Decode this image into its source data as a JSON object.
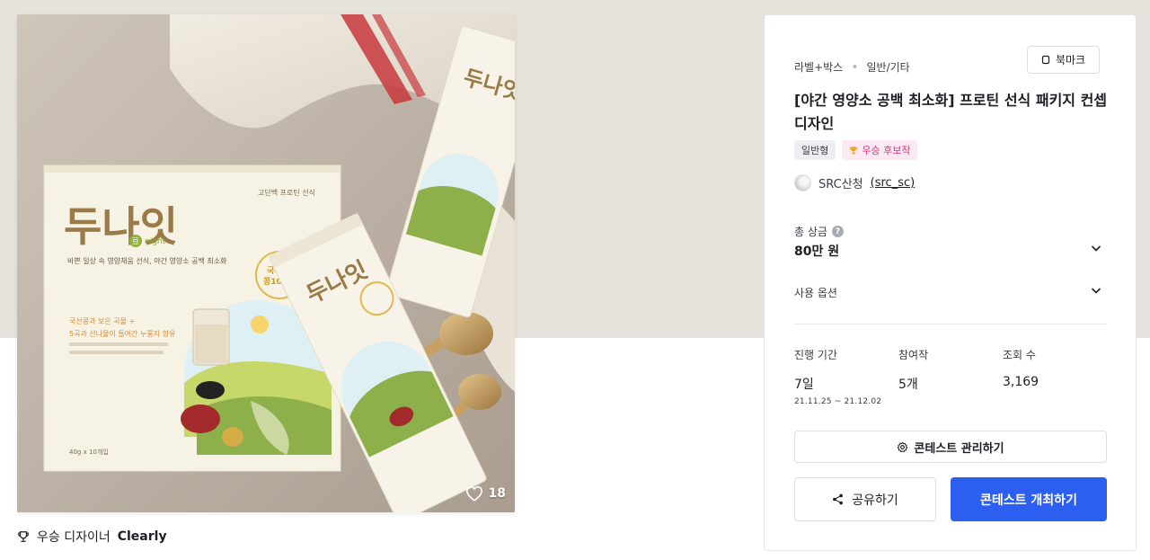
{
  "hero": {
    "box_brand": "두나잇",
    "box_sub_badge": "豆",
    "box_sub_text": "night",
    "box_top_text": "고단백 프로틴 선식",
    "box_tagline": "바쁜 일상 속 영양채움 선식, 야간 영양소 공백 최소화",
    "box_promo_1": "국산콩과 보은 곡물 +",
    "box_promo_2": "5곡과 산나물이 들어간 누룽지 향유",
    "box_weight": "40g x 10개입",
    "seal_text_1": "국내산",
    "seal_text_2": "콩100%",
    "stick_brand": "두나잇",
    "likes": "18",
    "colors": {
      "brand_brown": "#9a7b48",
      "cream": "#f6f2e4"
    }
  },
  "winner": {
    "label": "우승 디자이너",
    "name": "Clearly"
  },
  "panel": {
    "category": "라벨+박스",
    "subcategory": "일반/기타",
    "bookmark_label": "북마크",
    "title": "[야간 영양소 공백 최소화] 프로틴 선식 패키지 컨셉디자인",
    "tags": [
      "일반형",
      "우승 후보작"
    ],
    "host_name": "SRC산청",
    "host_id": "(src_sc)",
    "prize_label": "총 상금",
    "prize_help": "?",
    "prize_value": "80만 원",
    "options_label": "사용 옵션",
    "stats": {
      "period_label": "진행 기간",
      "period_value": "7일",
      "period_range": "21.11.25 ~ 21.12.02",
      "entries_label": "참여작",
      "entries_value": "5개",
      "views_label": "조회 수",
      "views_value": "3,169"
    },
    "manage_label": "콘테스트 관리하기",
    "share_label": "공유하기",
    "host_contest_label": "콘테스트 개최하기",
    "accent_color": "#2c5ef0"
  }
}
